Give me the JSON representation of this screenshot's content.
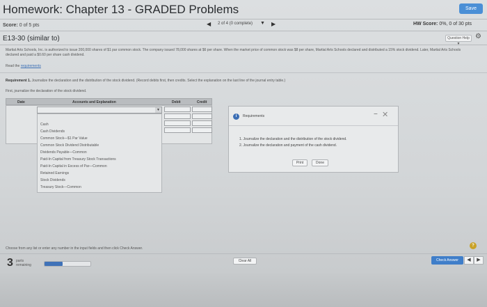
{
  "header": {
    "title": "Homework: Chapter 13 - GRADED Problems",
    "save_label": "Save"
  },
  "score_bar": {
    "score_label": "Score:",
    "score_value": "0 of 5 pts",
    "nav_text": "2 of 4 (0 complete)",
    "hw_score_label": "HW Score:",
    "hw_score_value": "0%, 0 of 30 pts"
  },
  "problem": {
    "title": "E13-30 (similar to)",
    "question_help_label": "Question Help ▼",
    "text": "Martial Arts Schools, Inc. is authorized to issue 200,000 shares of $1 par common stock. The company issued 78,000 shares at $6 per share. When the market price of common stock was $8 per share, Martial Arts Schools declared and distributed a 15% stock dividend. Later, Martial Arts Schools declared and paid a $0.60 per share cash dividend.",
    "read_prefix": "Read the",
    "read_link": "requirements",
    "requirement_bold": "Requirement 1.",
    "requirement_text": "Journalize the declaration and the distribution of the stock dividend. (Record debits first, then credits. Select the explanation on the last line of the journal entry table.)",
    "first_text": "First, journalize the declaration of the stock dividend."
  },
  "journal_table": {
    "col_date": "Date",
    "col_accounts": "Accounts and Explanation",
    "col_debit": "Debit",
    "col_credit": "Credit"
  },
  "dropdown_options": [
    "Cash",
    "Cash Dividends",
    "Common Stock—$1 Par Value",
    "Common Stock Dividend Distributable",
    "Dividends Payable—Common",
    "Paid-In Capital from Treasury Stock Transactions",
    "Paid-In Capital in Excess of Par—Common",
    "Retained Earnings",
    "Stock Dividends",
    "Treasury Stock—Common"
  ],
  "requirements_popup": {
    "title": "Requirements",
    "items": [
      "1.  Journalize the declaration and the distribution of the stock dividend.",
      "2.  Journalize the declaration and payment of the cash dividend."
    ],
    "print_label": "Print",
    "done_label": "Done"
  },
  "footer": {
    "choose_text": "Choose from any list or enter any number in the input fields and then click Check Answer.",
    "parts_number": "3",
    "parts_label_1": "parts",
    "parts_label_2": "remaining",
    "progress_fraction": 0.4,
    "clear_all_label": "Clear All",
    "check_answer_label": "Check Answer",
    "prev_arrow": "◀",
    "next_arrow": "▶"
  }
}
